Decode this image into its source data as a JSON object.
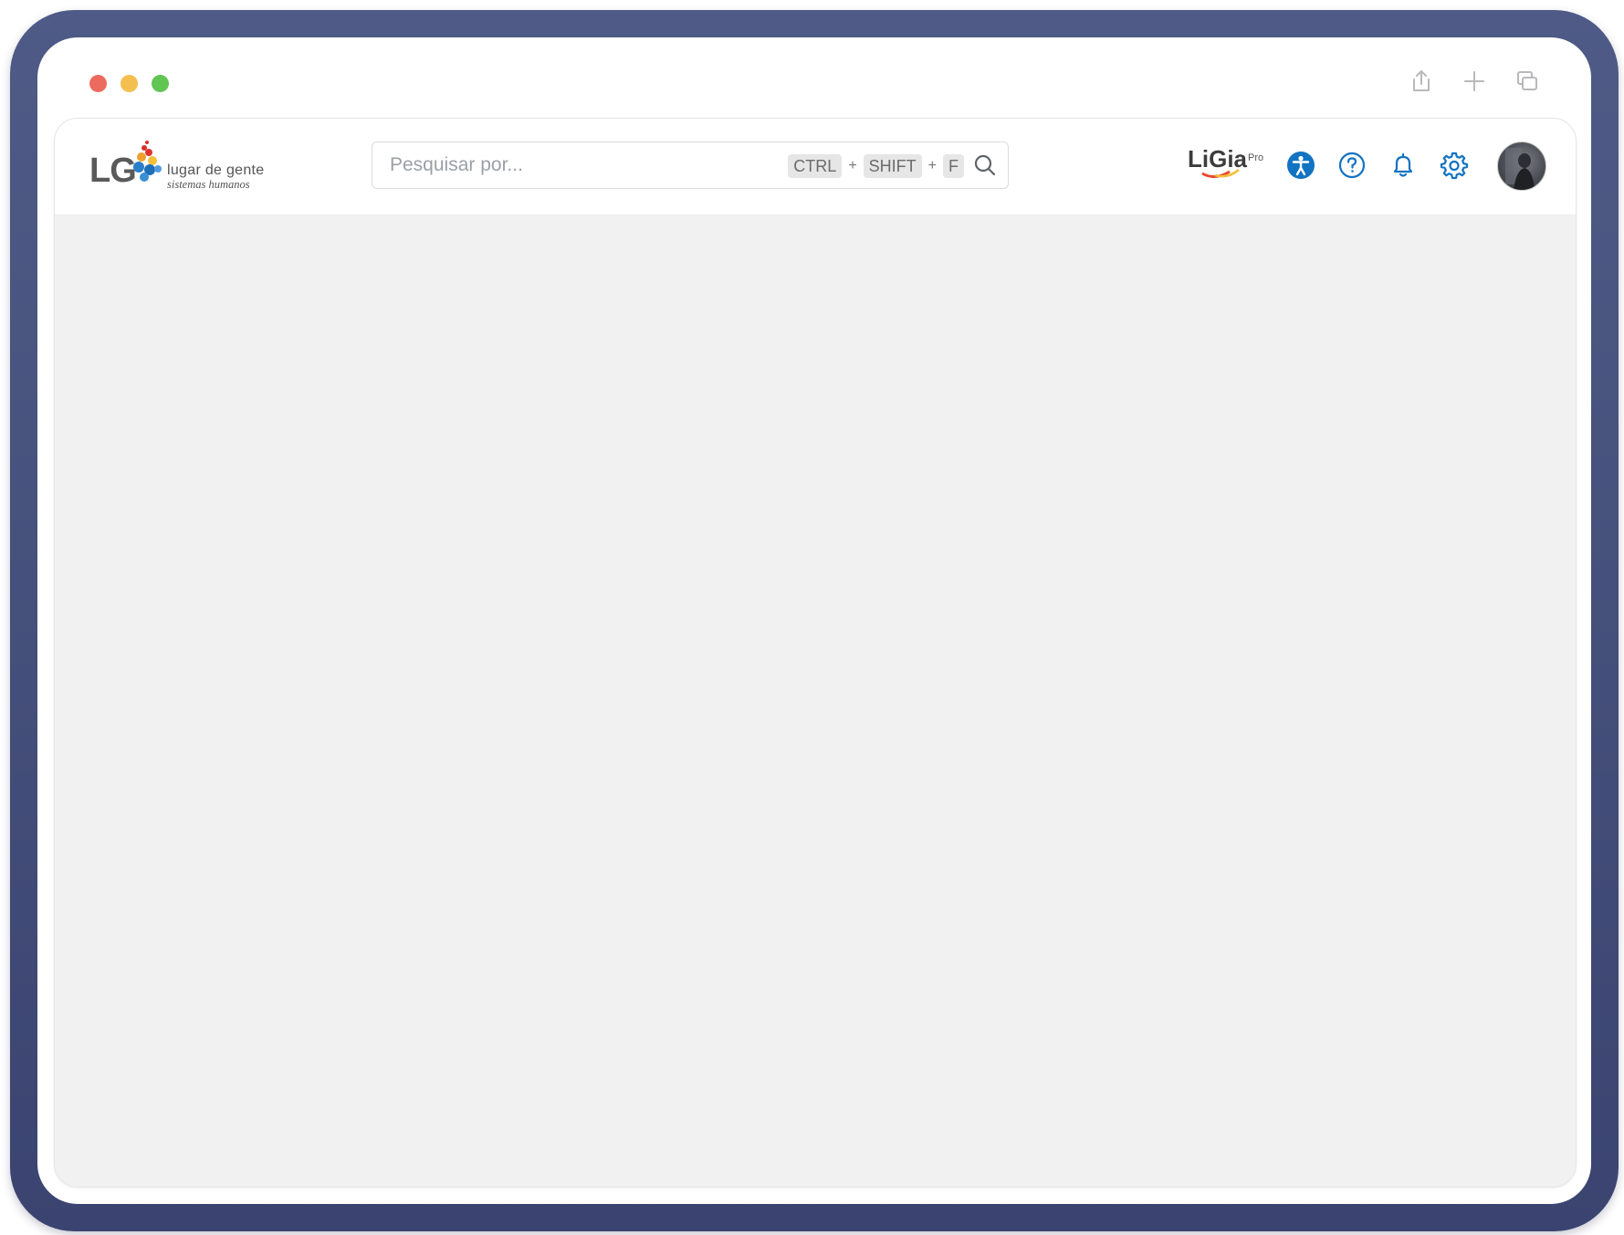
{
  "window": {
    "traffic_lights": [
      "close",
      "minimize",
      "zoom"
    ],
    "actions": [
      "share-icon",
      "plus-icon",
      "duplicate-window-icon"
    ]
  },
  "header": {
    "logo": {
      "mark": "LG",
      "name": "lugar de gente",
      "tagline": "sistemas humanos"
    },
    "search": {
      "placeholder": "Pesquisar por...",
      "shortcut_keys": [
        "CTRL",
        "SHIFT",
        "F"
      ],
      "shortcut_separator": "+"
    },
    "ligia_badge": {
      "name": "LiGia",
      "suffix": "Pro"
    },
    "icons": [
      "accessibility-icon",
      "help-icon",
      "bell-icon",
      "gear-icon"
    ],
    "accent_color": "#1273c2"
  },
  "colors": {
    "device_frame": "#4b5582",
    "content_background": "#f1f1f1"
  }
}
